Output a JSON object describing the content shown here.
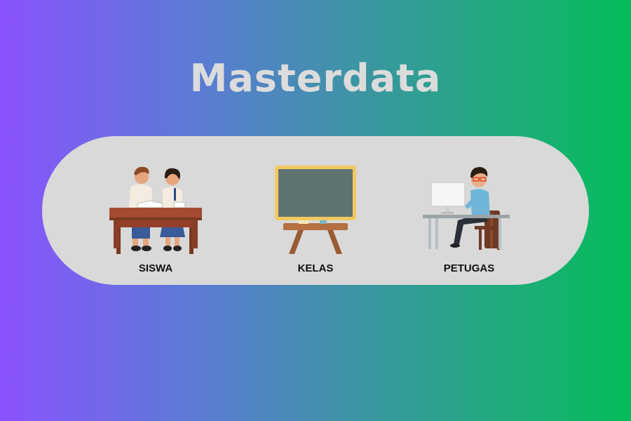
{
  "title": "Masterdata",
  "items": [
    {
      "label": "SISWA",
      "icon": "students-at-desk-icon"
    },
    {
      "label": "KELAS",
      "icon": "chalkboard-icon"
    },
    {
      "label": "PETUGAS",
      "icon": "officer-at-computer-icon"
    }
  ],
  "colors": {
    "gradient_start": "#8a52fe",
    "gradient_end": "#05bd5a",
    "panel": "#d9d9d9",
    "title": "#dcdcdc"
  }
}
